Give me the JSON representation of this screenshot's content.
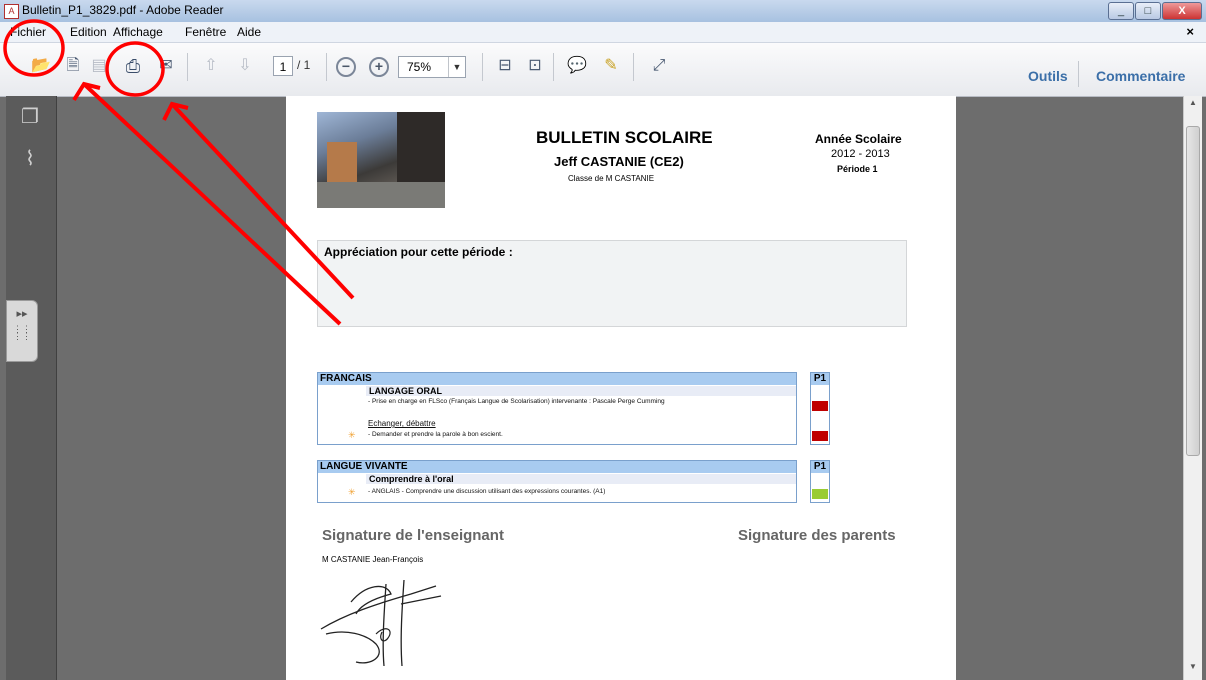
{
  "window": {
    "title": "Bulletin_P1_3829.pdf - Adobe Reader"
  },
  "menu": {
    "items": [
      "Fichier",
      "Edition",
      "Affichage",
      "Fenêtre",
      "Aide"
    ],
    "close_doc": "×"
  },
  "toolbar": {
    "page_current": "1",
    "page_total": "/ 1",
    "zoom": "75%",
    "tools_label": "Outils",
    "comment_label": "Commentaire"
  },
  "colors": {
    "accent": "#3b6fa8",
    "annotation_red": "#ff0000",
    "rating_red": "#c00000",
    "rating_green": "#99cc33"
  },
  "document": {
    "title": "BULLETIN SCOLAIRE",
    "student": "Jeff CASTANIE (CE2)",
    "class": "Classe de M CASTANIE",
    "year_label": "Année Scolaire",
    "year_value": "2012 - 2013",
    "period": "Période 1",
    "appreciation_label": "Appréciation pour cette période :",
    "sections": [
      {
        "name": "FRANCAIS",
        "col": "P1",
        "subsection": "LANGAGE ORAL",
        "item1": "- Prise en charge en FLSco (Français Langue de Scolarisation) intervenante : Pascale Perge Cumming",
        "sublink": "Echanger, débattre",
        "item2": "- Demander et prendre la parole à bon escient."
      },
      {
        "name": "LANGUE VIVANTE",
        "col": "P1",
        "subsection": "Comprendre à l'oral",
        "item1": "- ANGLAIS - Comprendre une discussion utilisant des expressions courantes. (A1)"
      }
    ],
    "signature_teacher": "Signature de l'enseignant",
    "signature_parents": "Signature des parents",
    "teacher_name": "M CASTANIE Jean-François"
  }
}
